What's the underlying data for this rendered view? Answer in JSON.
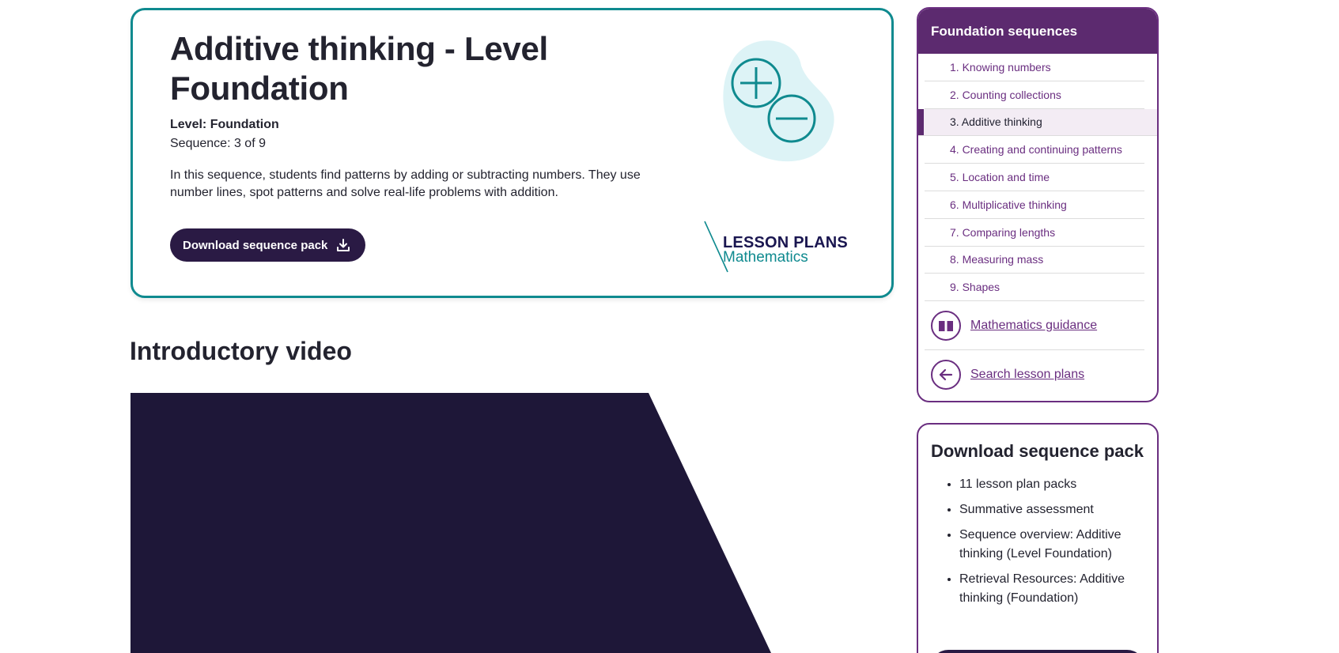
{
  "hero": {
    "title": "Additive thinking - Level Foundation",
    "level": "Level: Foundation",
    "sequence": "Sequence: 3 of 9",
    "description": "In this sequence, students find patterns by adding or subtracting numbers. They use number lines, spot patterns and solve real-life problems with addition.",
    "download_label": "Download sequence pack",
    "brand_line1": "LESSON PLANS",
    "brand_line2": "Mathematics"
  },
  "intro": {
    "heading": "Introductory video"
  },
  "sidebar": {
    "title": "Foundation sequences",
    "items": [
      {
        "label": "1. Knowing numbers"
      },
      {
        "label": "2. Counting collections"
      },
      {
        "label": "3. Additive thinking"
      },
      {
        "label": "4. Creating and continuing patterns"
      },
      {
        "label": "5. Location and time"
      },
      {
        "label": "6. Multiplicative thinking"
      },
      {
        "label": "7. Comparing lengths"
      },
      {
        "label": "8. Measuring mass"
      },
      {
        "label": "9. Shapes"
      }
    ],
    "active_index": 2,
    "guidance_link": "Mathematics guidance",
    "search_link": "Search lesson plans"
  },
  "download_panel": {
    "title": "Download sequence pack",
    "items": [
      "11 lesson plan packs",
      "Summative assessment",
      "Sequence overview: Additive thinking (Level Foundation)",
      "Retrieval Resources: Additive thinking (Foundation)"
    ]
  },
  "colors": {
    "teal": "#0f8a8f",
    "purple": "#5c2a6f",
    "link_purple": "#6a2e80",
    "dark_navy": "#2a1a44",
    "video_bg": "#1e1738",
    "icon_bg": "#ddf3f6"
  }
}
